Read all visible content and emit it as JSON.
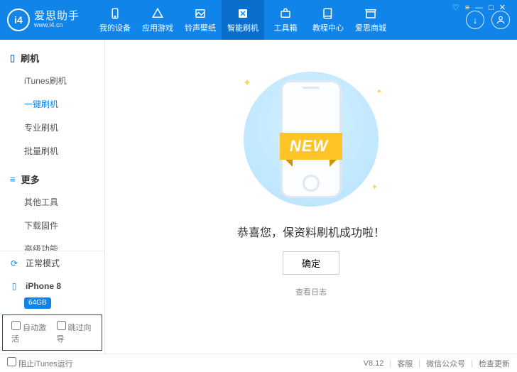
{
  "header": {
    "logo_symbol": "i4",
    "logo_title": "爱思助手",
    "logo_sub": "www.i4.cn",
    "tabs": [
      {
        "label": "我的设备"
      },
      {
        "label": "应用游戏"
      },
      {
        "label": "铃声壁纸"
      },
      {
        "label": "智能刷机"
      },
      {
        "label": "工具箱"
      },
      {
        "label": "教程中心"
      },
      {
        "label": "爱思商城"
      }
    ],
    "active_tab_index": 3
  },
  "sidebar": {
    "group1_title": "刷机",
    "group1_items": [
      "iTunes刷机",
      "一键刷机",
      "专业刷机",
      "批量刷机"
    ],
    "group1_active": 1,
    "group2_title": "更多",
    "group2_items": [
      "其他工具",
      "下载固件",
      "高级功能"
    ],
    "mode_label": "正常模式",
    "device_name": "iPhone 8",
    "device_capacity": "64GB",
    "checkbox_auto_activate": "自动激活",
    "checkbox_skip_wizard": "跳过向导"
  },
  "content": {
    "ribbon_text": "NEW",
    "success_message": "恭喜您，保资料刷机成功啦！",
    "confirm_button": "确定",
    "view_log": "查看日志"
  },
  "footer": {
    "block_itunes": "阻止iTunes运行",
    "version": "V8.12",
    "links": [
      "客服",
      "微信公众号",
      "检查更新"
    ]
  }
}
